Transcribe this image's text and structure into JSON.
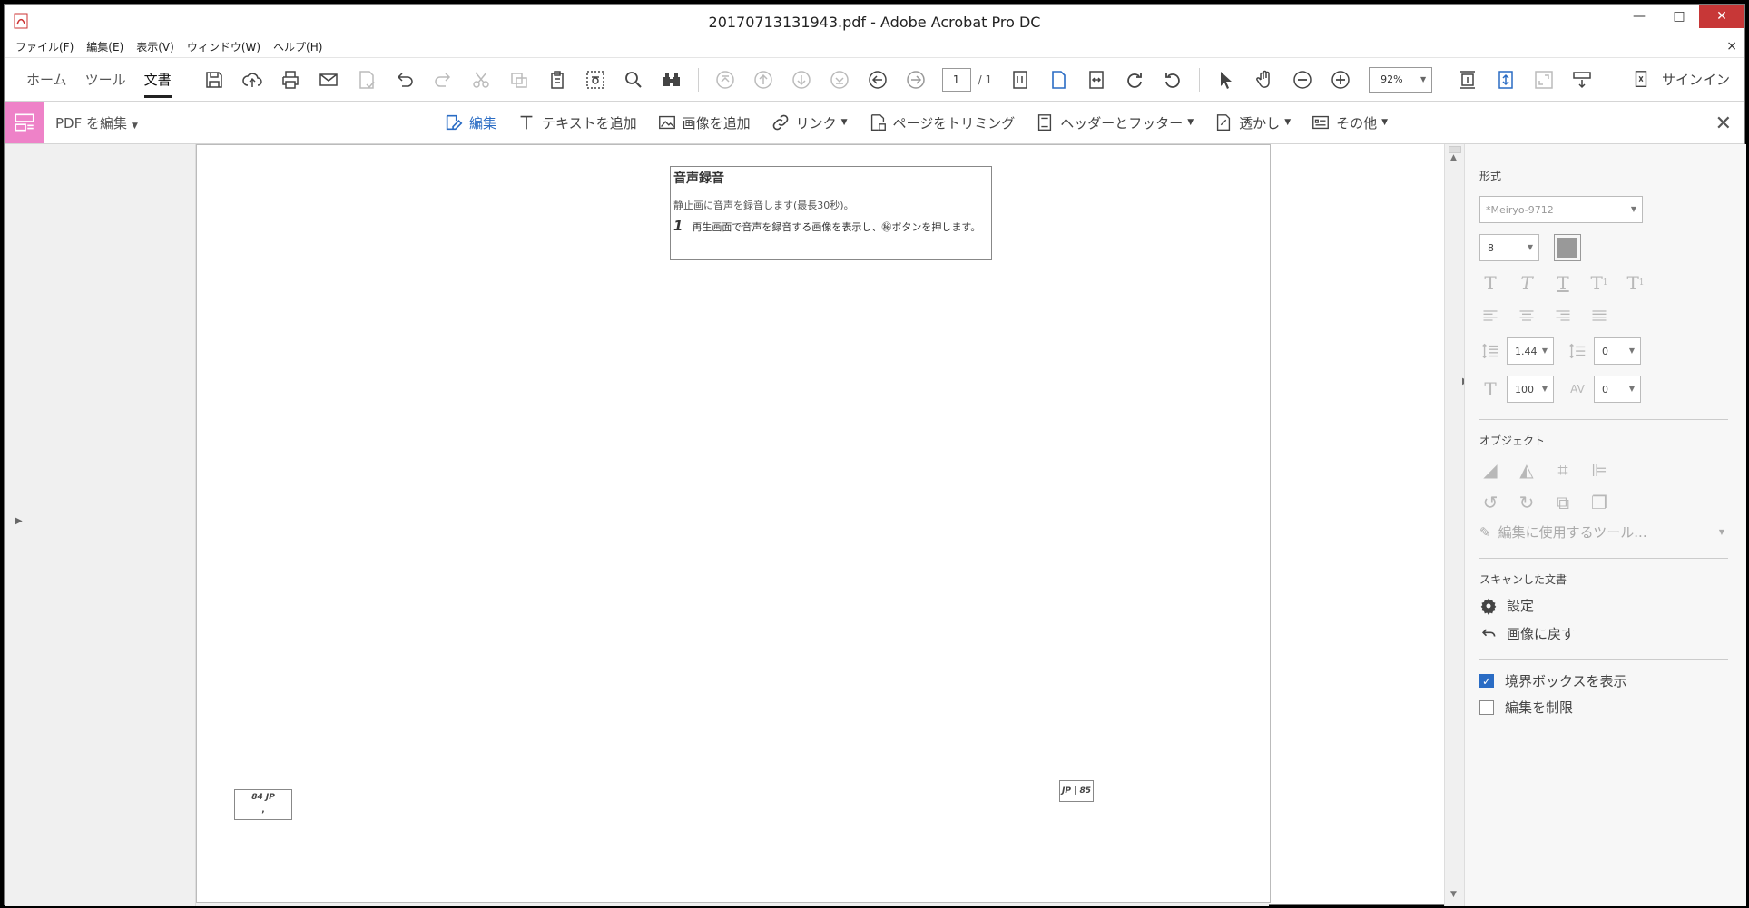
{
  "window": {
    "title": "20170713131943.pdf - Adobe Acrobat Pro DC",
    "controls": {
      "minimize": "—",
      "maximize": "□",
      "close": "✕"
    }
  },
  "menu": [
    "ファイル(F)",
    "編集(E)",
    "表示(V)",
    "ウィンドウ(W)",
    "ヘルプ(H)"
  ],
  "doc_close": "×",
  "nav_tabs": [
    "ホーム",
    "ツール",
    "文書"
  ],
  "active_tab": "文書",
  "page_nav": {
    "current": "1",
    "total": "/ 1"
  },
  "zoom": "92%",
  "signin": "サインイン",
  "edit_bar": {
    "title": "PDF を編集",
    "tools": [
      {
        "label": "編集",
        "icon": "edit-icon",
        "active": true
      },
      {
        "label": "テキストを追加",
        "icon": "text-icon"
      },
      {
        "label": "画像を追加",
        "icon": "image-icon"
      },
      {
        "label": "リンク",
        "icon": "link-icon",
        "dropdown": true
      },
      {
        "label": "ページをトリミング",
        "icon": "crop-page-icon"
      },
      {
        "label": "ヘッダーとフッター",
        "icon": "header-footer-icon",
        "dropdown": true
      },
      {
        "label": "透かし",
        "icon": "watermark-icon",
        "dropdown": true
      },
      {
        "label": "その他",
        "icon": "more-icon",
        "dropdown": true
      }
    ]
  },
  "document": {
    "heading": "音声録音",
    "line1": "静止画に音声を録音します(最長30秒)。",
    "step_number": "1",
    "step_text": "再生画面で音声を録音する画像を表示し、㊙ボタンを押します。",
    "footer_left": "84  JP",
    "footer_left_sub": ",",
    "footer_right": "JP | 85"
  },
  "props": {
    "format_title": "形式",
    "font": "*Meiryo-9712",
    "font_size": "8",
    "line_spacing": "1.44",
    "para_spacing": "0",
    "h_scale": "100",
    "char_spacing": "0",
    "object_title": "オブジェクト",
    "edit_with": "編集に使用するツール...",
    "scanned_title": "スキャンした文書",
    "settings": "設定",
    "revert": "画像に戻す",
    "show_bbox": "境界ボックスを表示",
    "show_bbox_checked": true,
    "restrict_edit": "編集を制限",
    "restrict_edit_checked": false
  },
  "colors": {
    "accent": "#2a6cc4",
    "edit_tile": "#ee82c8"
  }
}
